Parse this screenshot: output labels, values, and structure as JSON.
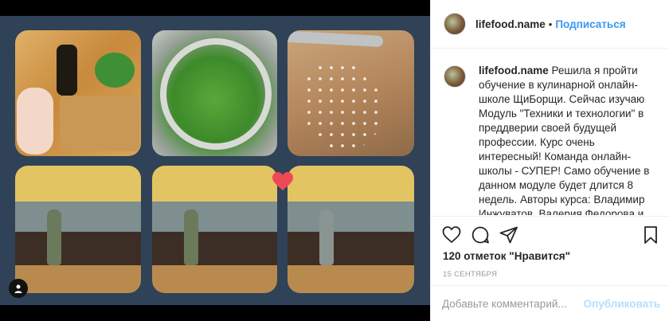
{
  "post": {
    "username": "lifefood.name",
    "follow_label": "Подписаться",
    "separator": "•",
    "caption": "Решила я пройти обучение в кулинарной онлайн-школе ЩиБорщи. Сейчас изучаю Модуль \"Техники и технологии\" в преддверии своей будущей профессии. Курс очень интересный! Команда онлайн-школы - СУПЕР! Само обучение в данном модуле будет длится 8 недель. Авторы курса: Владимир Инжуватов, Валерия Федорова и Айдар Гатауллин. Записывайтесь!",
    "likes": "120 отметок \"Нравится\"",
    "date": "15 СЕНТЯБРЯ"
  },
  "comment_form": {
    "placeholder": "Добавьте комментарий...",
    "publish_label": "Опубликовать"
  },
  "icons": {
    "like": "heart-outline-icon",
    "comment": "speech-bubble-icon",
    "share": "paper-plane-icon",
    "save": "bookmark-icon",
    "tag": "user-tag-icon",
    "collage_heart": "heart-filled-icon"
  },
  "colors": {
    "link_blue": "#3897f0",
    "publish_disabled": "#b2dffc",
    "collage_background": "#2f4257",
    "heart": "#ed4956"
  }
}
